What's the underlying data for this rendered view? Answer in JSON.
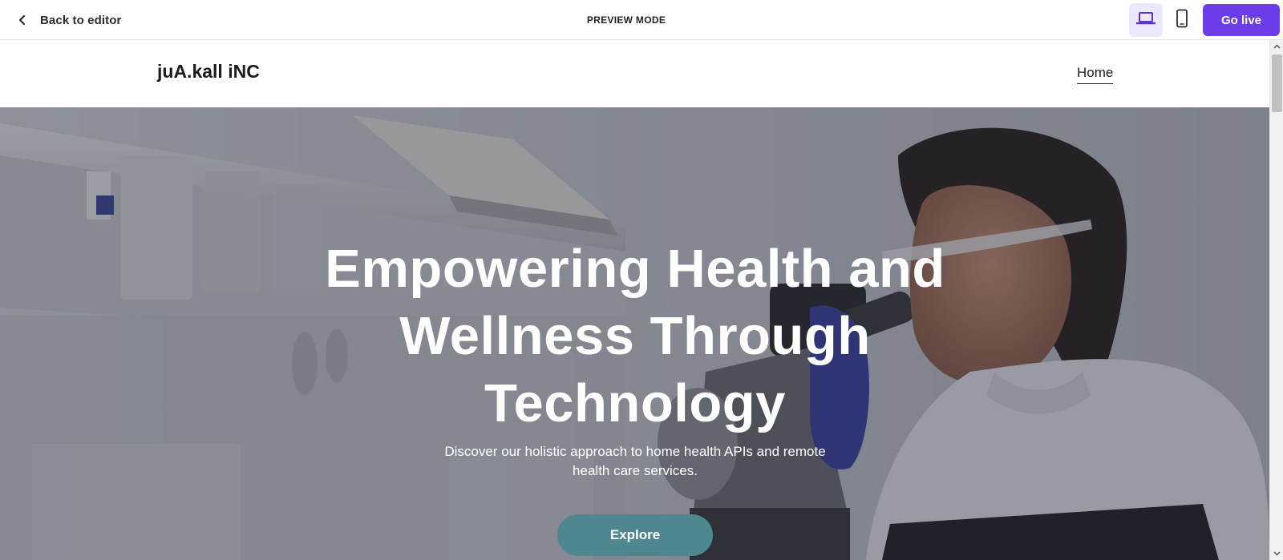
{
  "editor_bar": {
    "back_label": "Back to editor",
    "back_icon": "chevron-left-icon",
    "mode_label": "PREVIEW MODE",
    "desktop_icon": "laptop-icon",
    "mobile_icon": "smartphone-icon",
    "go_live_label": "Go live",
    "accent_color": "#6a3de8",
    "active_device_bg": "#ece8ff"
  },
  "site": {
    "brand": "juA.kall iNC",
    "nav": [
      {
        "label": "Home",
        "active": true
      }
    ]
  },
  "hero": {
    "title": "Empowering Health and Wellness Through Technology",
    "subtitle": "Discover our holistic approach to home health APIs and remote health care services.",
    "cta_label": "Explore",
    "cta_color": "#4f8790",
    "background": "lab-scientist-microscope-photo"
  },
  "scrollbar": {
    "up_icon": "scroll-up-arrow-icon",
    "down_icon": "scroll-down-arrow-icon"
  }
}
